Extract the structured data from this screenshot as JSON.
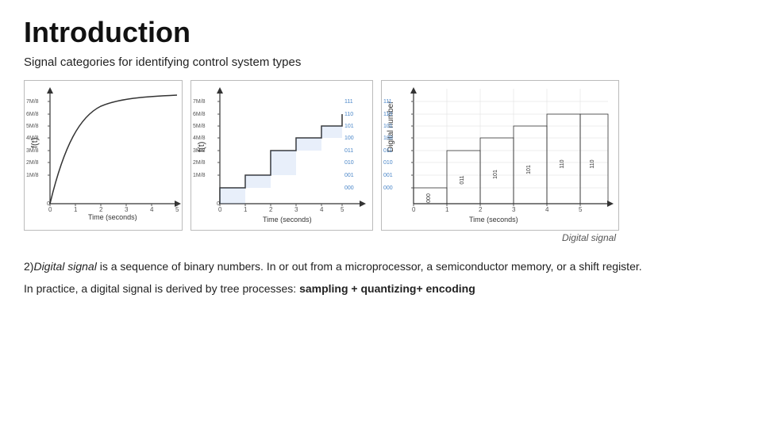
{
  "title": "Introduction",
  "subtitle": "Signal categories for identifying control system types",
  "digital_label": "Digital signal",
  "paragraph1_prefix": "2)",
  "paragraph1_italic": "Digital signal",
  "paragraph1_rest": " is a sequence of binary numbers. In or out from a microprocessor, a semiconductor memory, or a shift register.",
  "paragraph2_prefix": "In practice, a digital signal is derived by tree processes:  ",
  "paragraph2_bold": "sampling + quantizing+ encoding",
  "chart1_ylabel": "f(t)",
  "chart1_xlabel": "Time (seconds)",
  "chart2_ylabel": "f(t)",
  "chart2_xlabel": "Time (seconds)",
  "chart3_ylabel": "Digital number",
  "chart3_xlabel": "Time (seconds)",
  "y_labels": [
    "7M/8",
    "6M/8",
    "5M/8",
    "4M/8",
    "3M/8",
    "2M/8",
    "1M/8",
    "0"
  ],
  "binary_labels": [
    "111",
    "110",
    "101",
    "100",
    "011",
    "010",
    "001",
    "000"
  ],
  "x_ticks": [
    "0",
    "1",
    "2",
    "3",
    "4",
    "5"
  ]
}
